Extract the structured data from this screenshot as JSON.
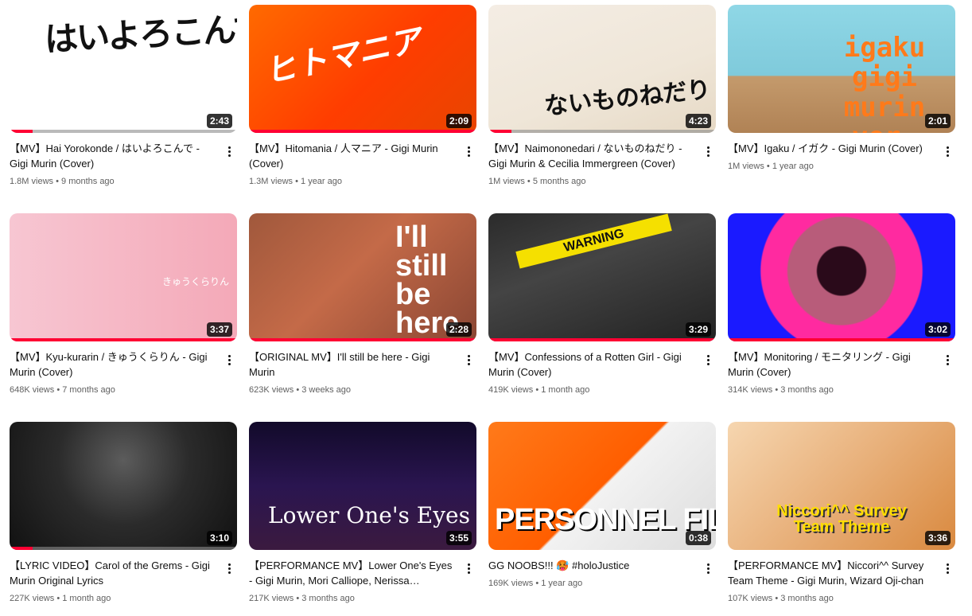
{
  "videos": [
    {
      "title": "【MV】Hai Yorokonde / はいよろこんで - Gigi Murin (Cover)",
      "views": "1.8M views",
      "age": "9 months ago",
      "duration": "2:43",
      "thumb_text": "はいよろこんで",
      "progress": 0.1
    },
    {
      "title": "【MV】Hitomania / 人マニア - Gigi Murin (Cover)",
      "views": "1.3M views",
      "age": "1 year ago",
      "duration": "2:09",
      "thumb_text": "ヒトマニア",
      "progress": 1
    },
    {
      "title": "【MV】Naimononedari / ないものねだり - Gigi Murin & Cecilia Immergreen (Cover)",
      "views": "1M views",
      "age": "5 months ago",
      "duration": "4:23",
      "thumb_text": "ないものねだり",
      "progress": 0.1
    },
    {
      "title": "【MV】Igaku / イガク - Gigi Murin (Cover)",
      "views": "1M views",
      "age": "1 year ago",
      "duration": "2:01",
      "thumb_text": "igaku gigi murin ver.",
      "progress": 0
    },
    {
      "title": "【MV】Kyu-kurarin / きゅうくらりん - Gigi Murin (Cover)",
      "views": "648K views",
      "age": "7 months ago",
      "duration": "3:37",
      "thumb_text": "きゅうくらりん",
      "progress": 1
    },
    {
      "title": "【ORIGINAL MV】I'll still be here - Gigi Murin",
      "views": "623K views",
      "age": "3 weeks ago",
      "duration": "2:28",
      "thumb_text": "I'll still be here",
      "progress": 1
    },
    {
      "title": "【MV】Confessions of a Rotten Girl - Gigi Murin (Cover)",
      "views": "419K views",
      "age": "1 month ago",
      "duration": "3:29",
      "thumb_text": "WARNING",
      "progress": 1
    },
    {
      "title": "【MV】Monitoring / モニタリング - Gigi Murin (Cover)",
      "views": "314K views",
      "age": "3 months ago",
      "duration": "3:02",
      "thumb_text": "",
      "progress": 1
    },
    {
      "title": "【LYRIC VIDEO】Carol of the Grems - Gigi Murin Original Lyrics",
      "views": "227K views",
      "age": "1 month ago",
      "duration": "3:10",
      "thumb_text": "",
      "progress": 0.1
    },
    {
      "title": "【PERFORMANCE MV】Lower One's Eyes - Gigi Murin, Mori Calliope, Nerissa Ravencroft",
      "views": "217K views",
      "age": "3 months ago",
      "duration": "3:55",
      "thumb_text": "Lower One's Eyes",
      "progress": 0
    },
    {
      "title": "GG NOOBS!!! 🥵 #holoJustice",
      "views": "169K views",
      "age": "1 year ago",
      "duration": "0:38",
      "thumb_text": "PERSONNEL FILE",
      "progress": 0
    },
    {
      "title": "【PERFORMANCE MV】Niccori^^ Survey Team Theme - Gigi Murin, Wizard Oji-chan",
      "views": "107K views",
      "age": "3 months ago",
      "duration": "3:36",
      "thumb_text": "Niccori^^ Survey Team Theme",
      "progress": 0
    }
  ],
  "colors": {
    "progress": "#ff0033",
    "meta": "#606060",
    "title": "#0f0f0f"
  },
  "icons": {
    "menu": "more-vert-icon"
  }
}
